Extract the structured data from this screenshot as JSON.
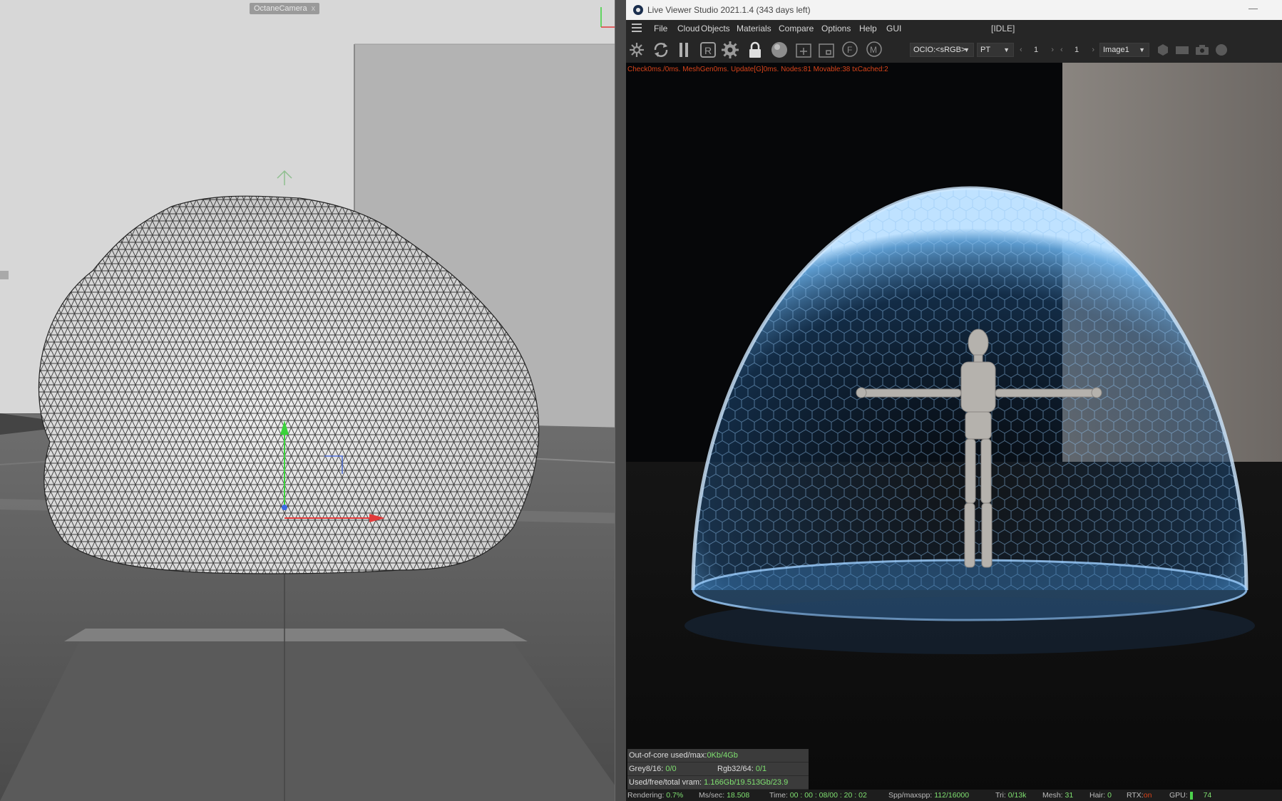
{
  "left_viewport": {
    "camera_label": "OctaneCamera",
    "camera_close": "x"
  },
  "window": {
    "title": "Live Viewer Studio 2021.1.4 (343 days left)",
    "minimize": "—"
  },
  "menu": {
    "items": [
      "File",
      "Cloud",
      "Objects",
      "Materials",
      "Compare",
      "Options",
      "Help",
      "GUI"
    ],
    "status": "[IDLE]"
  },
  "toolbar": {
    "ocio": "OCIO:<sRGB>",
    "kernel": "PT",
    "num1": "1",
    "num2": "1",
    "image": "Image1",
    "icons": [
      "send-scene-icon",
      "restart-icon",
      "pause-icon",
      "region-render-icon",
      "settings-gear-icon",
      "lock-icon",
      "material-ball-icon",
      "add-region-icon",
      "focus-pick-icon",
      "focus-icon",
      "material-pick-icon"
    ]
  },
  "stats_line": "Check0ms./0ms. MeshGen0ms. Update[G]0ms. Nodes:81 Movable:38 txCached:2",
  "info": {
    "ooc_label": "Out-of-core used/max:",
    "ooc_value": "0Kb/4Gb",
    "grey_label": "Grey8/16:",
    "grey_value": "0/0",
    "rgb_label": "Rgb32/64:",
    "rgb_value": "0/1",
    "vram_label": "Used/free/total vram:",
    "vram_value": "1.166Gb/19.513Gb/23.9"
  },
  "status": {
    "rendering_label": "Rendering:",
    "rendering_value": "0.7%",
    "ms_label": "Ms/sec:",
    "ms_value": "18.508",
    "time_label": "Time:",
    "time_value": "00 : 00 : 08/00 : 20 : 02",
    "spp_label": "Spp/maxspp:",
    "spp_value": "112/16000",
    "tri_label": "Tri:",
    "tri_value": "0/13k",
    "mesh_label": "Mesh:",
    "mesh_value": "31",
    "hair_label": "Hair:",
    "hair_value": "0",
    "rtx_label": "RTX:",
    "rtx_value": "on",
    "gpu_label": "GPU:",
    "gpu_value": "74"
  }
}
